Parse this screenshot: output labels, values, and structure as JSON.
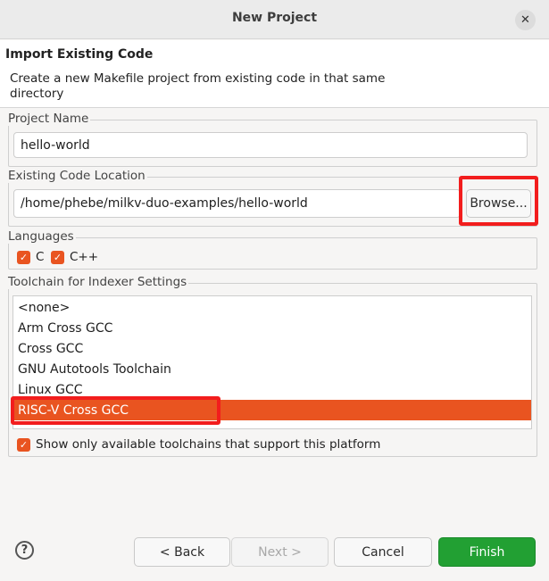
{
  "window": {
    "title": "New Project",
    "close_glyph": "✕"
  },
  "page": {
    "heading": "Import Existing Code",
    "description": "Create a new Makefile project from existing code in that same directory"
  },
  "project_name": {
    "label": "Project Name",
    "value": "hello-world"
  },
  "code_location": {
    "label": "Existing Code Location",
    "value": "/home/phebe/milkv-duo-examples/hello-world",
    "browse_label": "Browse..."
  },
  "languages": {
    "label": "Languages",
    "items": [
      {
        "label": "C",
        "checked": true
      },
      {
        "label": "C++",
        "checked": true
      }
    ]
  },
  "toolchain": {
    "label": "Toolchain for Indexer Settings",
    "items": [
      {
        "label": "<none>"
      },
      {
        "label": "Arm Cross GCC"
      },
      {
        "label": "Cross GCC"
      },
      {
        "label": "GNU Autotools Toolchain"
      },
      {
        "label": "Linux GCC"
      },
      {
        "label": "RISC-V Cross GCC"
      }
    ],
    "selected_index": 5,
    "filter_label": "Show only available toolchains that support this platform",
    "filter_checked": true
  },
  "footer": {
    "back_label": "< Back",
    "next_label": "Next >",
    "cancel_label": "Cancel",
    "finish_label": "Finish"
  },
  "colors": {
    "accent": "#e95420",
    "finish": "#22a033",
    "highlight_annotation": "#f21d1d"
  },
  "icons": {
    "help": "help-icon",
    "close": "close-icon",
    "check": "check-icon"
  }
}
